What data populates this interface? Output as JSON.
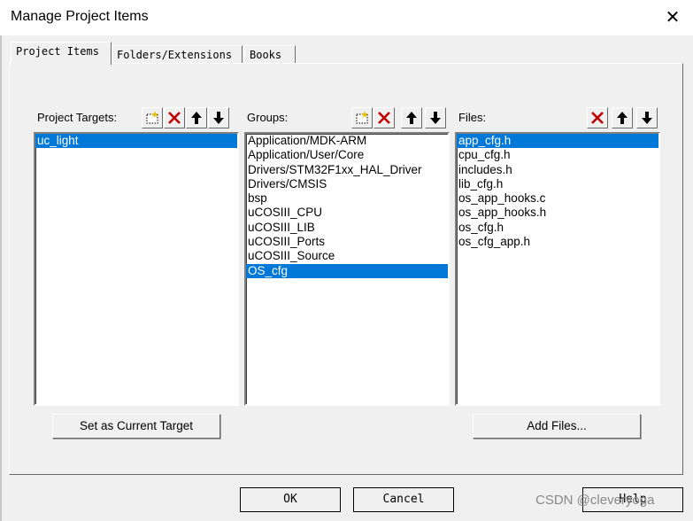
{
  "window": {
    "title": "Manage Project Items",
    "close_label": "✕"
  },
  "tabs": [
    {
      "label": "Project Items",
      "active": true
    },
    {
      "label": "Folders/Extensions",
      "active": false
    },
    {
      "label": "Books",
      "active": false
    }
  ],
  "targets": {
    "label": "Project Targets:",
    "items": [
      "uc_light"
    ],
    "selected": 0
  },
  "groups": {
    "label": "Groups:",
    "items": [
      "Application/MDK-ARM",
      "Application/User/Core",
      "Drivers/STM32F1xx_HAL_Driver",
      "Drivers/CMSIS",
      "bsp",
      "uCOSIII_CPU",
      "uCOSIII_LIB",
      "uCOSIII_Ports",
      "uCOSIII_Source",
      "OS_cfg"
    ],
    "selected": 9
  },
  "files": {
    "label": "Files:",
    "items": [
      "app_cfg.h",
      "cpu_cfg.h",
      "includes.h",
      "lib_cfg.h",
      "os_app_hooks.c",
      "os_app_hooks.h",
      "os_cfg.h",
      "os_cfg_app.h"
    ],
    "selected": 0
  },
  "buttons": {
    "set_current": "Set as Current Target",
    "add_files": "Add Files...",
    "ok": "OK",
    "cancel": "Cancel",
    "help": "Help"
  },
  "watermark": "CSDN @cleveryoga",
  "colors": {
    "selection": "#0078d7",
    "delete_icon": "#c00000"
  }
}
